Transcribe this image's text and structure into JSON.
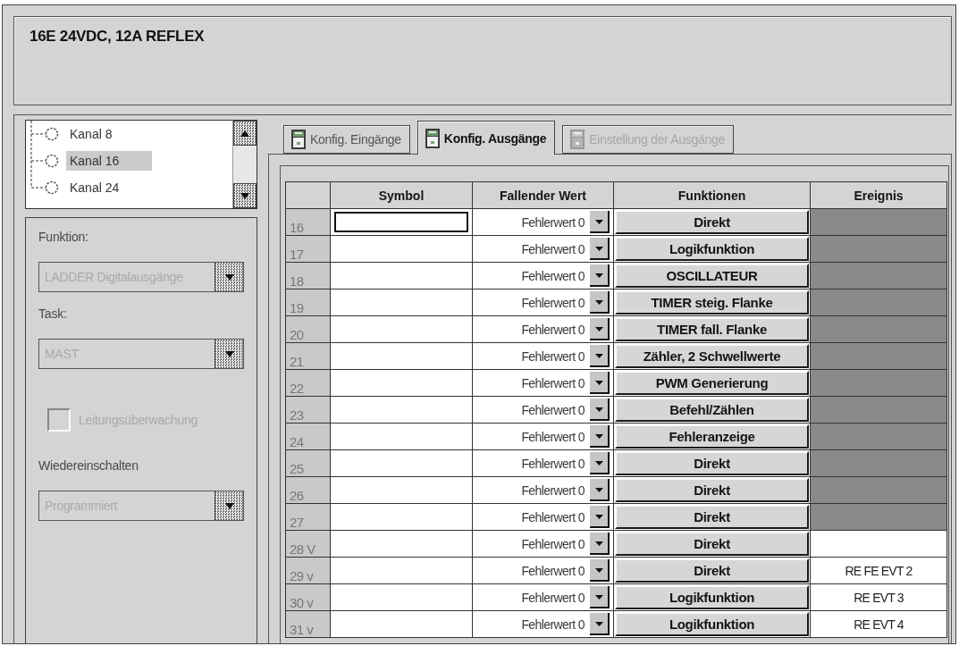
{
  "window": {
    "title": "16E 24VDC, 12A REFLEX"
  },
  "channels": [
    {
      "label": "Kanal 8",
      "selected": false
    },
    {
      "label": "Kanal 16",
      "selected": true
    },
    {
      "label": "Kanal 24",
      "selected": false
    }
  ],
  "fields": [
    {
      "kind": "combo",
      "label": "Funktion:",
      "value": "LADDER Digitalausgänge",
      "disabled": true
    },
    {
      "kind": "combo",
      "label": "Task:",
      "value": "MAST",
      "disabled": true
    },
    {
      "kind": "checkbox",
      "label": "Leitungsüberwachung",
      "checked": false,
      "disabled": true
    },
    {
      "kind": "combo",
      "label": "Wiedereinschalten",
      "value": "Programmiert",
      "disabled": true
    }
  ],
  "tabs": [
    {
      "label": "Konfig. Eingänge",
      "selected": false,
      "disabled": false
    },
    {
      "label": "Konfig. Ausgänge",
      "selected": true,
      "disabled": false
    },
    {
      "label": "Einstellung der Ausgänge",
      "selected": false,
      "disabled": true
    }
  ],
  "table": {
    "columns": [
      "Symbol",
      "Fallender Wert",
      "Funktionen",
      "Ereignis"
    ],
    "rows": [
      {
        "channel": "16",
        "focused": true,
        "fallback": "Fehlerwert 0",
        "function": "Direkt",
        "event_disabled": true
      },
      {
        "channel": "17",
        "focused": false,
        "fallback": "Fehlerwert 0",
        "function": "Logikfunktion",
        "event_disabled": true
      },
      {
        "channel": "18",
        "focused": false,
        "fallback": "Fehlerwert 0",
        "function": "OSCILLATEUR",
        "event_disabled": true
      },
      {
        "channel": "19",
        "focused": false,
        "fallback": "Fehlerwert 0",
        "function": "TIMER steig. Flanke",
        "event_disabled": true
      },
      {
        "channel": "20",
        "focused": false,
        "fallback": "Fehlerwert 0",
        "function": "TIMER fall. Flanke",
        "event_disabled": true
      },
      {
        "channel": "21",
        "focused": false,
        "fallback": "Fehlerwert 0",
        "function": "Zähler, 2 Schwellwerte",
        "event_disabled": true
      },
      {
        "channel": "22",
        "focused": false,
        "fallback": "Fehlerwert 0",
        "function": "PWM Generierung",
        "event_disabled": true
      },
      {
        "channel": "23",
        "focused": false,
        "fallback": "Fehlerwert 0",
        "function": "Befehl/Zählen",
        "event_disabled": true
      },
      {
        "channel": "24",
        "focused": false,
        "fallback": "Fehlerwert 0",
        "function": "Fehleranzeige",
        "event_disabled": true
      },
      {
        "channel": "25",
        "focused": false,
        "fallback": "Fehlerwert 0",
        "function": "Direkt",
        "event_disabled": true
      },
      {
        "channel": "26",
        "focused": false,
        "fallback": "Fehlerwert 0",
        "function": "Direkt",
        "event_disabled": true
      },
      {
        "channel": "27",
        "focused": false,
        "fallback": "Fehlerwert 0",
        "function": "Direkt",
        "event_disabled": true
      },
      {
        "channel": "28 V",
        "focused": false,
        "fallback": "Fehlerwert 0",
        "function": "Direkt",
        "event_disabled": false
      },
      {
        "channel": "29 v",
        "focused": false,
        "fallback": "Fehlerwert 0",
        "function": "Direkt",
        "event_disabled": false,
        "event": "RE FE EVT 2"
      },
      {
        "channel": "30 v",
        "focused": false,
        "fallback": "Fehlerwert 0",
        "function": "Logikfunktion",
        "event_disabled": false,
        "event": "RE EVT 3"
      },
      {
        "channel": "31 v",
        "focused": false,
        "fallback": "Fehlerwert 0",
        "function": "Logikfunktion",
        "event_disabled": false,
        "event": "RE EVT 4"
      }
    ]
  }
}
